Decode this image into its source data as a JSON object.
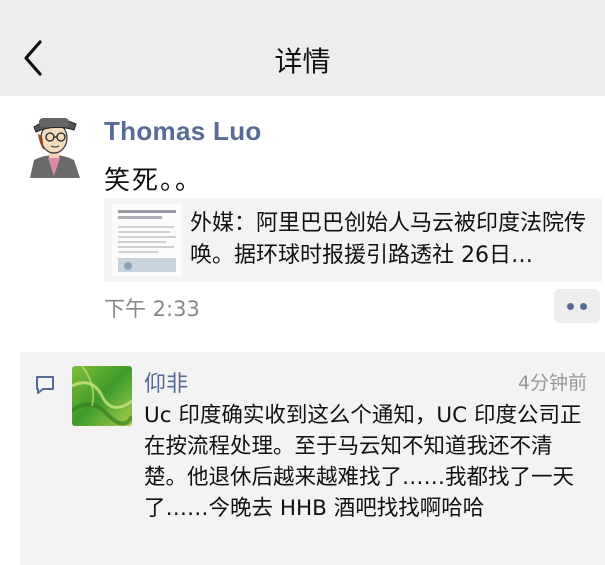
{
  "navbar": {
    "title": "详情",
    "back_icon": "chevron-left-icon"
  },
  "post": {
    "author": "Thomas Luo",
    "text": "笑死。。",
    "link": {
      "title": "外媒：阿里巴巴创始人马云被印度法院传唤。据环球时报援引路透社 26日…"
    },
    "time": "下午 2:33",
    "more_icon": "more-dots-icon"
  },
  "comments": [
    {
      "icon": "comment-bubble-icon",
      "name": "仰非",
      "time": "4分钟前",
      "text": "Uc 印度确实收到这么个通知，UC 印度公司正在按流程处理。至于马云知不知道我还不清楚。他退休后越来越难找了……我都找了一天了……今晚去 HHB 酒吧找找啊哈哈"
    }
  ],
  "colors": {
    "link_blue": "#576b95",
    "nav_bg": "#ededed",
    "card_bg": "#f3f3f3"
  }
}
